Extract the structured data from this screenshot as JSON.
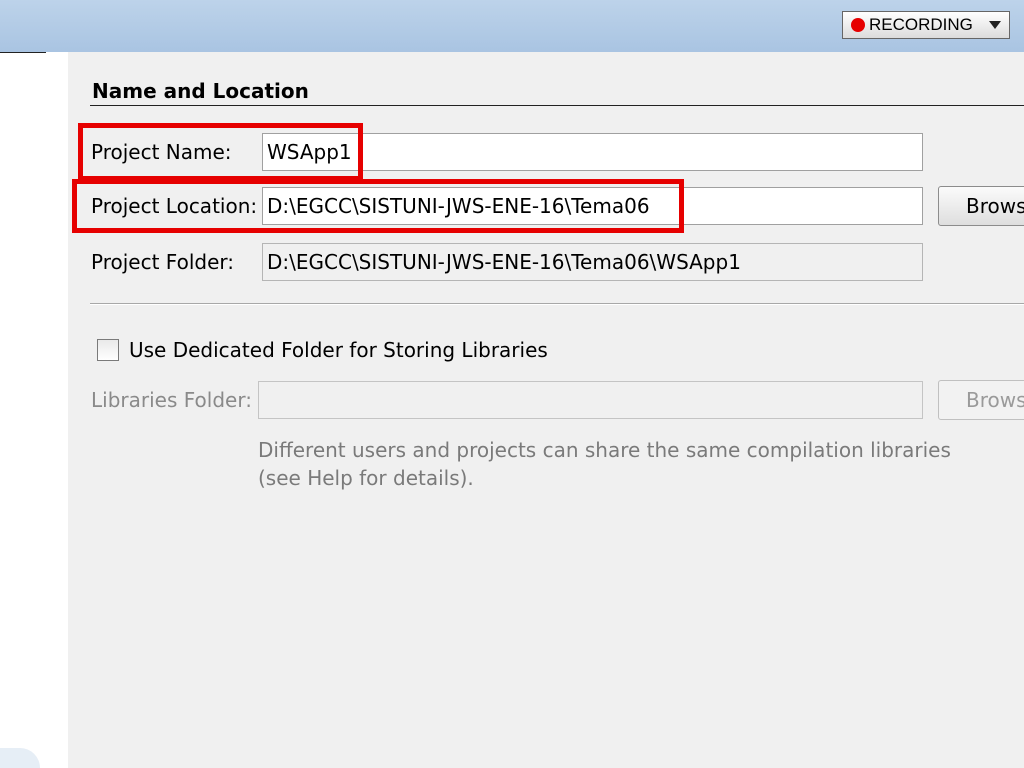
{
  "recording": {
    "label": "RECORDING",
    "dot_color": "#e60000"
  },
  "section": {
    "title": "Name and Location"
  },
  "project_name": {
    "label": "Project Name:",
    "value": "WSApp1"
  },
  "project_location": {
    "label": "Project Location:",
    "value": "D:\\EGCC\\SISTUNI-JWS-ENE-16\\Tema06",
    "browse_label": "Browse..."
  },
  "project_folder": {
    "label": "Project Folder:",
    "value": "D:\\EGCC\\SISTUNI-JWS-ENE-16\\Tema06\\WSApp1"
  },
  "libraries": {
    "checkbox_label": "Use Dedicated Folder for Storing Libraries",
    "checked": false,
    "folder_label": "Libraries Folder:",
    "folder_value": "",
    "browse_label": "Browse...",
    "hint_line1": "Different users and projects can share the same compilation libraries",
    "hint_line2": "(see Help for details)."
  },
  "colors": {
    "highlight": "#e60000",
    "topbar": "#a9c4e2"
  }
}
